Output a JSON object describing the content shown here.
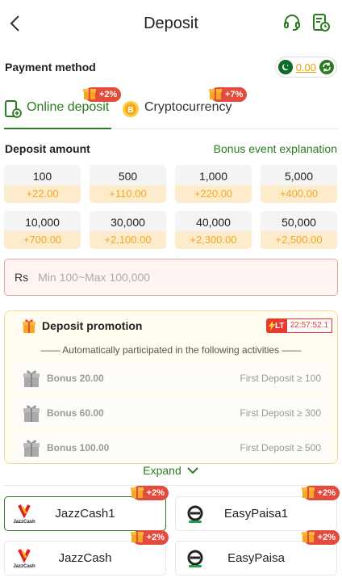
{
  "header": {
    "title": "Deposit"
  },
  "payment_method": {
    "title": "Payment method",
    "balance": "0.00"
  },
  "tabs": [
    {
      "label": "Online deposit",
      "bonus": "+2%"
    },
    {
      "label": "Cryptocurrency",
      "bonus": "+7%"
    }
  ],
  "deposit_amount": {
    "title": "Deposit amount",
    "bonus_link": "Bonus event explanation"
  },
  "amounts": [
    {
      "value": "100",
      "bonus": "+22.00"
    },
    {
      "value": "500",
      "bonus": "+110.00"
    },
    {
      "value": "1,000",
      "bonus": "+220.00"
    },
    {
      "value": "5,000",
      "bonus": "+400.00"
    },
    {
      "value": "10,000",
      "bonus": "+700.00"
    },
    {
      "value": "30,000",
      "bonus": "+2,100.00"
    },
    {
      "value": "40,000",
      "bonus": "+2,300.00"
    },
    {
      "value": "50,000",
      "bonus": "+2,500.00"
    }
  ],
  "input": {
    "currency": "Rs",
    "placeholder": "Min 100~Max 100,000"
  },
  "promotion": {
    "title": "Deposit promotion",
    "timer_label": "LT",
    "timer": "22:57:52.1",
    "subtitle": "—— Automatically participated in the following activities ——",
    "items": [
      {
        "name": "Bonus 20.00",
        "condition": "First Deposit ≥ 100"
      },
      {
        "name": "Bonus 60.00",
        "condition": "First Deposit ≥ 300"
      },
      {
        "name": "Bonus 100.00",
        "condition": "First Deposit ≥ 500"
      }
    ],
    "expand_label": "Expand"
  },
  "channels": [
    {
      "name": "JazzCash1",
      "bonus": "+2%",
      "logo": "jazzcash-logo",
      "logo_text": "JazzCash"
    },
    {
      "name": "EasyPaisa1",
      "bonus": "+2%",
      "logo": "easypaisa-logo"
    },
    {
      "name": "JazzCash",
      "bonus": "+2%",
      "logo": "jazzcash-logo",
      "logo_text": "JazzCash"
    },
    {
      "name": "EasyPaisa",
      "bonus": "+2%",
      "logo": "easypaisa-logo"
    }
  ],
  "colors": {
    "accent": "#2c7a21",
    "bonus": "#f5a623",
    "tag": "#e34c3c",
    "timer": "#e63b2e"
  }
}
